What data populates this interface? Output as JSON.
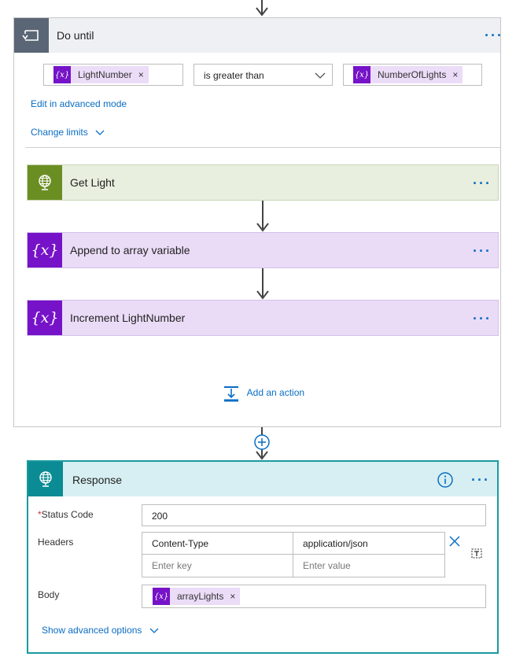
{
  "do_until": {
    "title": "Do until",
    "condition": {
      "left_token": "LightNumber",
      "operator": "is greater than",
      "right_token": "NumberOfLights"
    },
    "edit_advanced_label": "Edit in advanced mode",
    "change_limits_label": "Change limits",
    "actions": [
      {
        "title": "Get Light"
      },
      {
        "title": "Append to array variable"
      },
      {
        "title": "Increment LightNumber"
      }
    ],
    "add_action_label": "Add an action"
  },
  "response": {
    "title": "Response",
    "status_code_label": "Status Code",
    "status_code_value": "200",
    "headers_label": "Headers",
    "headers": [
      {
        "key": "Content-Type",
        "value": "application/json"
      }
    ],
    "headers_key_placeholder": "Enter key",
    "headers_value_placeholder": "Enter value",
    "body_label": "Body",
    "body_token": "arrayLights",
    "show_advanced_label": "Show advanced options"
  },
  "colors": {
    "variable_purple": "#7613c8",
    "variable_bg": "#ebdcf7",
    "http_green": "#6b8e23",
    "response_teal": "#0b8b94",
    "link_blue": "#0a6dc4"
  }
}
